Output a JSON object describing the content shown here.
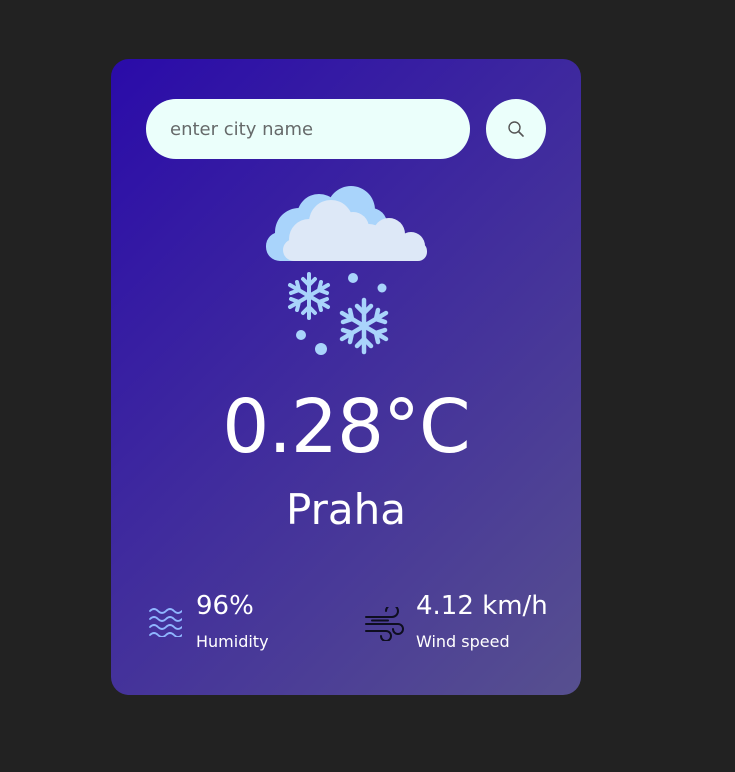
{
  "search": {
    "placeholder": "enter city name",
    "value": "",
    "button_icon": "search-icon"
  },
  "weather": {
    "icon": "snow-cloud-icon",
    "temperature": "0.28°C",
    "city": "Praha"
  },
  "details": {
    "humidity": {
      "icon": "water-waves-icon",
      "value": "96%",
      "label": "Humidity"
    },
    "wind": {
      "icon": "wind-icon",
      "value": "4.12 km/h",
      "label": "Wind speed"
    }
  },
  "colors": {
    "page_background": "#222222",
    "card_gradient_start": "#2a0ba9",
    "card_gradient_end": "#57508f",
    "input_background": "#ebfffb",
    "text": "#ffffff"
  }
}
